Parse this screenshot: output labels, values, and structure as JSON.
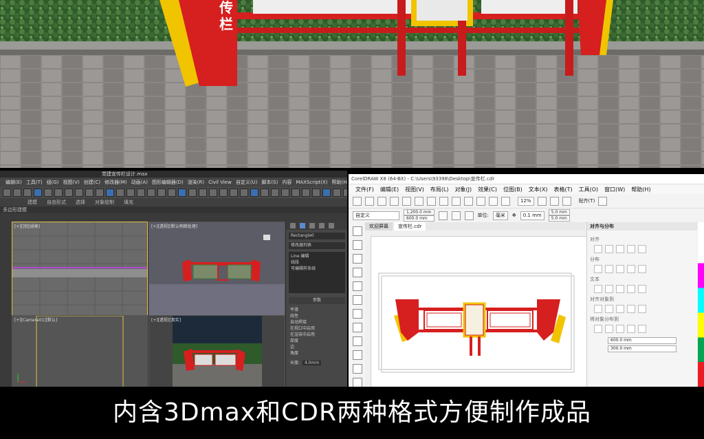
{
  "hero": {
    "vertical_text_left": "栏",
    "vertical_text_left_top": "传"
  },
  "max": {
    "window_title": "党建宣传栏设计.max",
    "menus": [
      "编辑(E)",
      "工具(T)",
      "组(G)",
      "视图(V)",
      "创建(C)",
      "修改器(M)",
      "动画(A)",
      "图形编辑器(D)",
      "渲染(R)",
      "Civil View",
      "自定义(U)",
      "脚本(S)",
      "内容",
      "MAXScript(X)",
      "帮助(H)"
    ],
    "ribbon": [
      "建模",
      "自由形式",
      "选择",
      "对象绘制",
      "填充"
    ],
    "subbar": "多边形建模",
    "search_placeholder": "键入关键字或短语",
    "viewport_labels": [
      "[+][顶][线框]",
      "[+][透视][默认明暗处理]",
      "[+][Camera01][默认]",
      "[+][透视][真实]"
    ],
    "cmd_object": "Rectangle0",
    "cmd_list": "修改器列表",
    "cmd_items": [
      "Line 编辑",
      "线段",
      "可编辑样条线"
    ],
    "params_title": "参数",
    "params": [
      "平滑",
      "线性",
      "自动焊接",
      "在视口中启用",
      "在渲染中启用",
      "厚度",
      "边",
      "角度"
    ],
    "length_label": "长度:",
    "length": "4.0mm"
  },
  "cdr": {
    "window_title": "CorelDRAW X8 (64-Bit) - C:\\Users\\93398\\Desktop\\宣传栏.cdr",
    "menus": [
      "文件(F)",
      "编辑(E)",
      "视图(V)",
      "布局(L)",
      "对象(J)",
      "效果(C)",
      "位图(B)",
      "文本(X)",
      "表格(T)",
      "工具(O)",
      "窗口(W)",
      "帮助(H)"
    ],
    "zoom": "12%",
    "snap_label": "贴齐(T)",
    "preset": "自定义",
    "width": "1,200.0 mm",
    "height": "600.0 mm",
    "unit_label": "单位:",
    "unit": "毫米",
    "nudge": "0.1 mm",
    "dup_x": "5.0 mm",
    "dup_y": "5.0 mm",
    "tabs": [
      "欢迎屏幕",
      "宣传栏.cdr"
    ],
    "docker_title": "对齐与分布",
    "docker_sections": [
      "对齐",
      "分布",
      "文本",
      "对齐对象到",
      "将对象分布到"
    ],
    "docker_w": "600.0 mm",
    "docker_h": "300.0 mm"
  },
  "caption": "内含3Dmax和CDR两种格式方便制作成品"
}
